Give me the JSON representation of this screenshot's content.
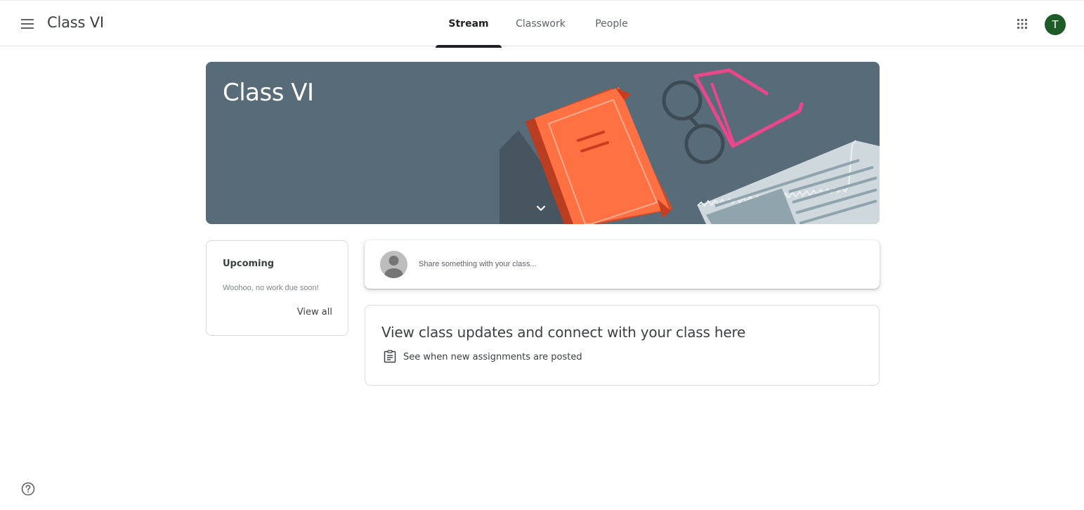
{
  "header": {
    "menu_icon": "hamburger-menu-icon",
    "title": "Class VI",
    "tabs": [
      {
        "label": "Stream",
        "active": true
      },
      {
        "label": "Classwork",
        "active": false
      },
      {
        "label": "People",
        "active": false
      }
    ],
    "apps_icon": "apps-grid-icon",
    "avatar_letter": "T",
    "avatar_color": "#1e5b28"
  },
  "banner": {
    "title": "Class VI",
    "background_color": "#576b78",
    "expand_icon": "chevron-down-icon"
  },
  "upcoming": {
    "title": "Upcoming",
    "empty_text": "Woohoo, no work due soon!",
    "view_all": "View all"
  },
  "share": {
    "placeholder": "Share something with your class..."
  },
  "updates": {
    "title": "View class updates and connect with your class here",
    "item_text": "See when new assignments are posted",
    "item_icon": "assignment-icon"
  },
  "footer": {
    "help_icon": "help-icon"
  }
}
